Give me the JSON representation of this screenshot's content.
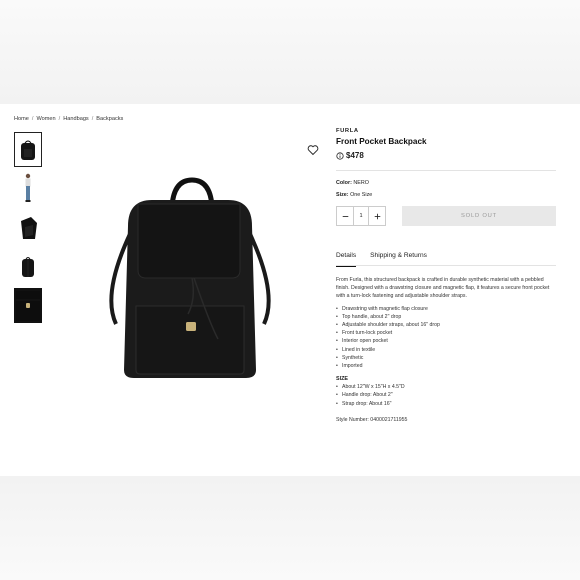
{
  "breadcrumb": {
    "items": [
      "Home",
      "Women",
      "Handbags",
      "Backpacks"
    ],
    "sep": "/"
  },
  "thumbnails": [
    "backpack-front",
    "model-wearing",
    "backpack-angle",
    "backpack-side",
    "backpack-detail"
  ],
  "product": {
    "brand": "FURLA",
    "title": "Front Pocket Backpack",
    "price": "$478",
    "color_label": "Color:",
    "color_value": "NERO",
    "size_label": "Size:",
    "size_value": "One Size",
    "qty": "1",
    "sold_out": "SOLD OUT"
  },
  "tabs": {
    "details": "Details",
    "shipping": "Shipping & Returns"
  },
  "details": {
    "description": "From Furla, this structured backpack is crafted in durable synthetic material with a pebbled finish. Designed with a drawstring closure and magnetic flap, it features a secure front pocket with a turn-lock fastening and adjustable shoulder straps.",
    "bullets": [
      "Drawstring with magnetic flap closure",
      "Top handle, about 2\" drop",
      "Adjustable shoulder straps, about 16\" drop",
      "Front turn-lock pocket",
      "Interior open pocket",
      "Lined in textile",
      "Synthetic",
      "Imported"
    ],
    "size_heading": "SIZE",
    "size_bullets": [
      "About 12\"W x 15\"H x 4.5\"D",
      "Handle drop: About 2\"",
      "Strap drop: About 16\""
    ],
    "style_number": "Style Number: 0400021711955"
  },
  "icons": {
    "wishlist": "heart-outline-icon",
    "info": "info-circle-icon",
    "minus": "minus-icon",
    "plus": "plus-icon"
  },
  "colors": {
    "accent": "#111111",
    "soldout_bg": "#e8e8e8",
    "soldout_text": "#999999"
  }
}
